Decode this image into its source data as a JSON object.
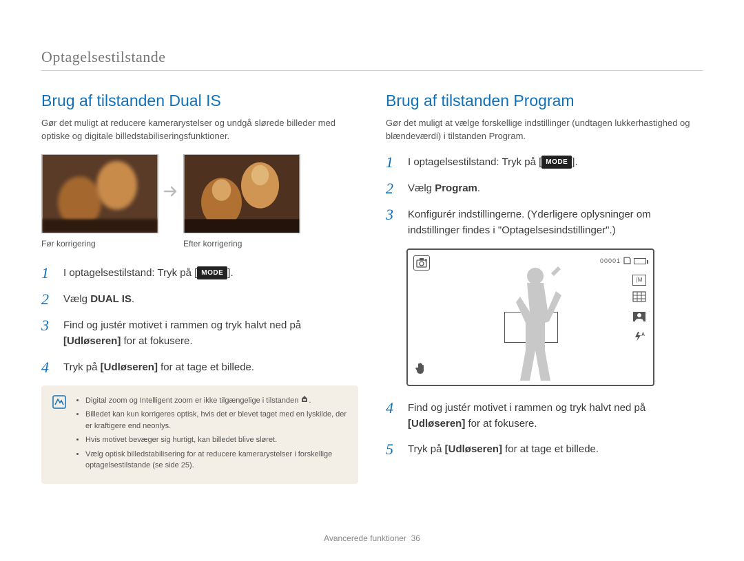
{
  "header": {
    "section": "Optagelsestilstande"
  },
  "left": {
    "title": "Brug af tilstanden Dual IS",
    "intro": "Gør det muligt at reducere kamerarystelser og undgå slørede billeder med optiske og digitale billedstabiliseringsfunktioner.",
    "caption_before": "Før korrigering",
    "caption_after": "Efter korrigering",
    "steps": {
      "s1_pre": "I optagelsestilstand: Tryk på [",
      "s1_post": "].",
      "mode_label": "MODE",
      "s2_pre": "Vælg ",
      "s2_bold": "DUAL IS",
      "s2_post": ".",
      "s3_line1_pre": "Find og justér motivet i rammen og tryk halvt ned på ",
      "s3_line1_bold": "[Udløseren]",
      "s3_line1_post": " for at fokusere.",
      "s4_pre": "Tryk på ",
      "s4_bold": "[Udløseren]",
      "s4_post": " for at tage et billede."
    },
    "notes": [
      "Digital zoom og Intelligent zoom er ikke tilgængelige i tilstanden ",
      "Billedet kan kun korrigeres optisk, hvis det er blevet taget med en lyskilde, der er kraftigere end neonlys.",
      "Hvis motivet bevæger sig hurtigt, kan billedet blive sløret.",
      "Vælg optisk billedstabilisering for at reducere kamerarystelser i forskellige optagelsestilstande (se side 25)."
    ]
  },
  "right": {
    "title": "Brug af tilstanden Program",
    "intro": "Gør det muligt at vælge forskellige indstillinger (undtagen lukkerhastighed og blændeværdi) i tilstanden Program.",
    "steps": {
      "s1_pre": "I optagelsestilstand: Tryk på [",
      "s1_post": "].",
      "mode_label": "MODE",
      "s2_pre": "Vælg ",
      "s2_bold": "Program",
      "s2_post": ".",
      "s3": "Konfigurér indstillingerne. (Yderligere oplysninger om indstillinger findes i \"Optagelsesindstillinger\".)",
      "s4_line1_pre": "Find og justér motivet i rammen og tryk halvt ned på ",
      "s4_line1_bold": "[Udløseren]",
      "s4_line1_post": " for at fokusere.",
      "s5_pre": "Tryk på ",
      "s5_bold": "[Udløseren]",
      "s5_post": " for at tage et billede."
    },
    "screen": {
      "counter": "00001",
      "card": "📷",
      "im": "|M",
      "flash": "⚡A"
    }
  },
  "footer": {
    "label": "Avancerede funktioner",
    "page": "36"
  },
  "nums": {
    "n1": "1",
    "n2": "2",
    "n3": "3",
    "n4": "4",
    "n5": "5"
  },
  "icons": {
    "note_suffix": "."
  }
}
